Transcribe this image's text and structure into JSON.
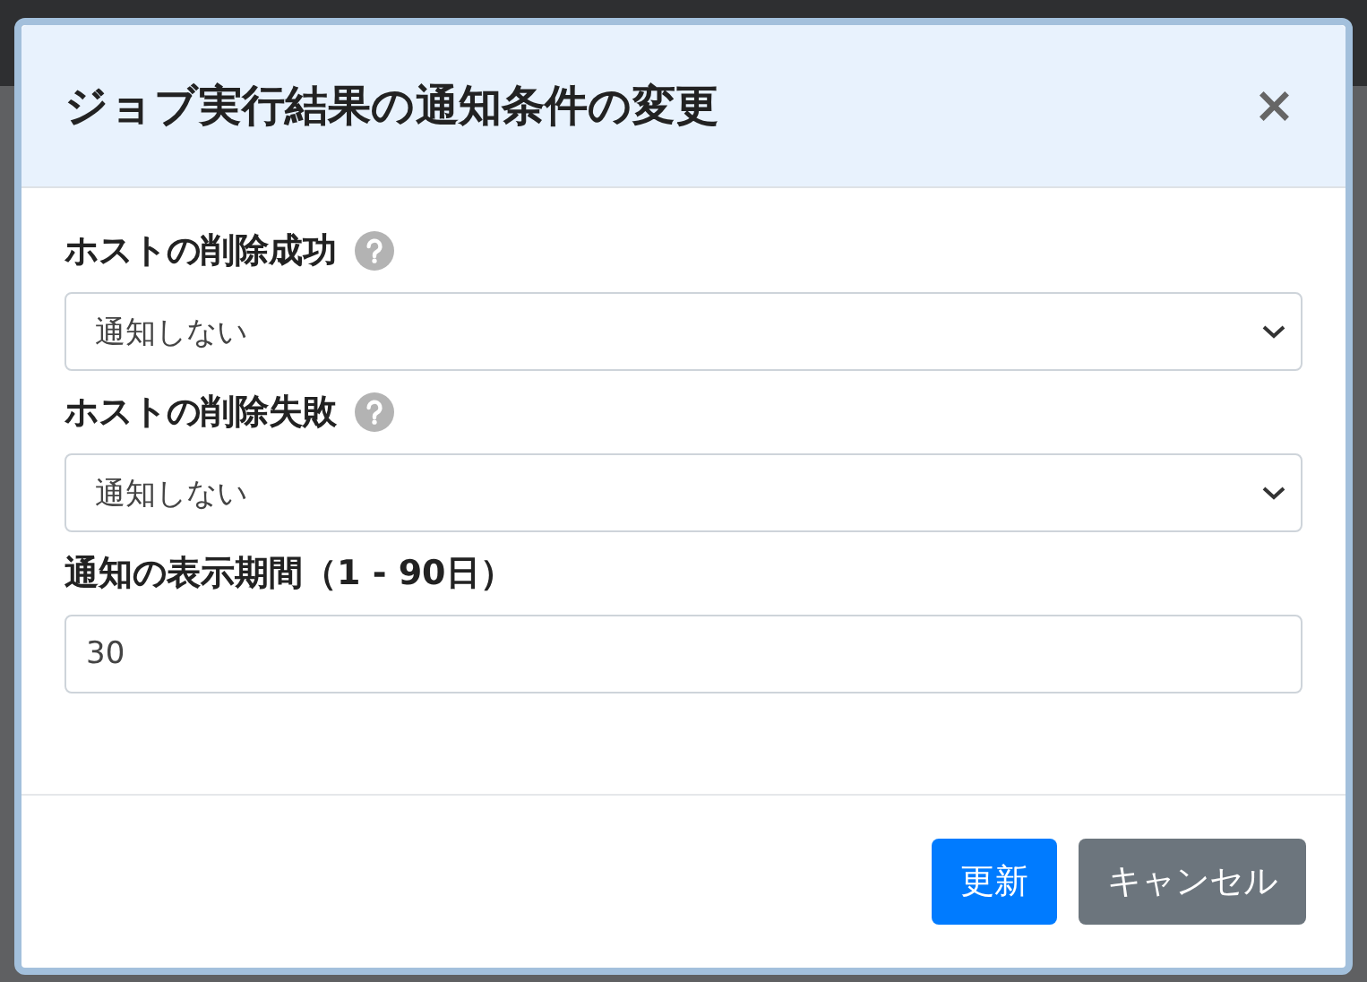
{
  "dialog": {
    "title": "ジョブ実行結果の通知条件の変更",
    "close": "×",
    "fields": [
      {
        "kind": "select",
        "label": "ホストの削除成功",
        "help": true,
        "value": "通知しない"
      },
      {
        "kind": "select",
        "label": "ホストの削除失敗",
        "help": true,
        "value": "通知しない"
      },
      {
        "kind": "text",
        "label": "通知の表示期間（1 - 90日）",
        "help": false,
        "value": "30"
      }
    ],
    "buttons": [
      {
        "label": "更新",
        "kind": "primary"
      },
      {
        "label": "キャンセル",
        "kind": "secondary"
      }
    ]
  }
}
